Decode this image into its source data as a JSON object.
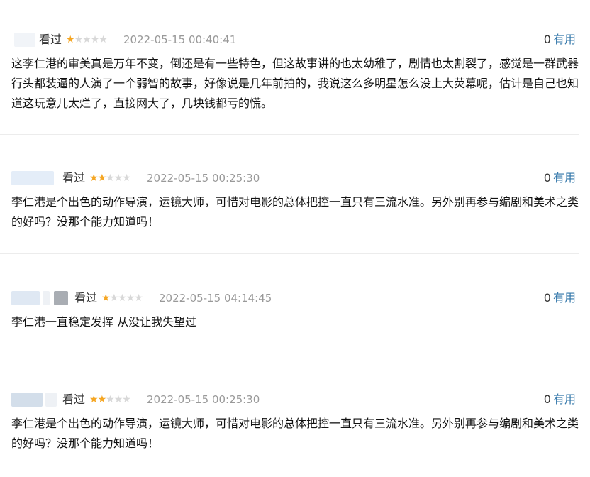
{
  "comments": [
    {
      "status": "看过",
      "rating": 1,
      "time": "2022-05-15 00:40:41",
      "useful_count": "0",
      "useful_label": "有用",
      "text": "这李仁港的审美真是万年不变，倒还是有一些特色，但这故事讲的也太幼稚了，剧情也太割裂了，感觉是一群武器行头都装逼的人演了一个弱智的故事，好像说是几年前拍的，我说这么多明星怎么没上大荧幕呢，估计是自己也知道这玩意儿太烂了，直接网大了，几块钱都亏的慌。"
    },
    {
      "status": "看过",
      "rating": 2,
      "time": "2022-05-15 00:25:30",
      "useful_count": "0",
      "useful_label": "有用",
      "text": "李仁港是个出色的动作导演，运镜大师，可惜对电影的总体把控一直只有三流水准。另外别再参与编剧和美术之类的好吗？没那个能力知道吗！"
    },
    {
      "status": "看过",
      "rating": 1,
      "time": "2022-05-15 04:14:45",
      "useful_count": "0",
      "useful_label": "有用",
      "text": "李仁港一直稳定发挥 从没让我失望过"
    },
    {
      "status": "看过",
      "rating": 2,
      "time": "2022-05-15 00:25:30",
      "useful_count": "0",
      "useful_label": "有用",
      "text": "李仁港是个出色的动作导演，运镜大师，可惜对电影的总体把控一直只有三流水准。另外别再参与编剧和美术之类的好吗？没那个能力知道吗！"
    }
  ],
  "rating_max": 5,
  "colors": {
    "star_on": "#f5a623",
    "star_off": "#d8d8d8",
    "useful_link": "#3377aa",
    "timestamp": "#999999",
    "username_blur": "#dbe6f3"
  }
}
